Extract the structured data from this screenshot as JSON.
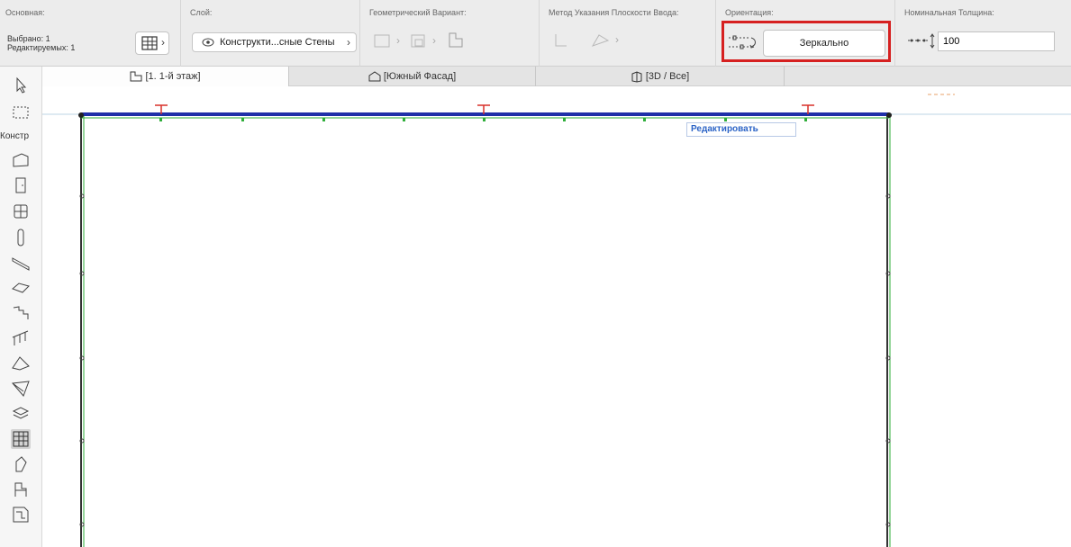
{
  "infobox": {
    "main": {
      "title": "Основная:",
      "selected": "Выбрано: 1",
      "editable": "Редактируемых: 1"
    },
    "layer": {
      "title": "Слой:",
      "value": "Конструкти...сные Стены"
    },
    "geometry": {
      "title": "Геометрический Вариант:"
    },
    "method": {
      "title": "Метод Указания Плоскости Ввода:"
    },
    "orientation": {
      "title": "Ориентация:",
      "button_label": "Зеркально"
    },
    "thickness": {
      "title": "Номинальная Толщина:",
      "value": "100"
    }
  },
  "tabs": [
    {
      "label": "[1. 1-й этаж]",
      "icon": "floor-plan-icon",
      "active": true
    },
    {
      "label": "[Южный Фасад]",
      "icon": "elevation-icon",
      "active": false
    },
    {
      "label": "[3D / Все]",
      "icon": "3d-view-icon",
      "active": false
    }
  ],
  "toolbox": {
    "section_label": "Констр",
    "tools": [
      "arrow-icon",
      "marquee-icon",
      "wall-icon",
      "door-icon",
      "window-icon",
      "column-icon",
      "beam-icon",
      "slab-icon",
      "stair-icon",
      "railing-icon",
      "roof-icon",
      "shell-icon",
      "morph-icon",
      "curtain-wall-icon",
      "skylight-icon",
      "object-icon",
      "zone-icon"
    ],
    "selected_tool": "curtain-wall-icon"
  },
  "canvas": {
    "edit_label": "Редактировать",
    "colors": {
      "wall": "#1f2fa8",
      "grid": "#2fae3a",
      "marker": "#d9302a"
    }
  }
}
